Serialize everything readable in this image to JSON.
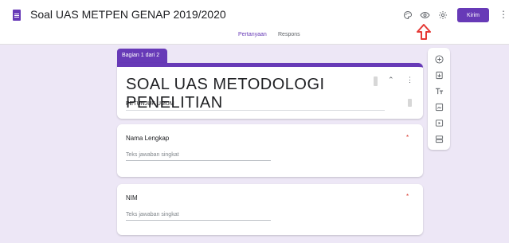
{
  "app": {
    "doc_title": "Soal UAS METPEN GENAP 2019/2020",
    "send_label": "Kirim"
  },
  "toolbar_icons": [
    "palette-icon",
    "preview-eye-icon",
    "settings-gear-icon",
    "more-vert-icon"
  ],
  "annotation": {
    "arrow_color": "#e53935",
    "points_to": "preview-eye-icon"
  },
  "tabs": [
    {
      "label": "Pertanyaan",
      "active": true
    },
    {
      "label": "Respons",
      "active": false
    }
  ],
  "section": {
    "tag_label": "Bagian 1 dari 2"
  },
  "form": {
    "title": "SOAL UAS METODOLOGI PENELITIAN",
    "description": "PETUNJUK UMUM"
  },
  "questions": [
    {
      "label": "Nama Lengkap",
      "placeholder": "Teks jawaban singkat",
      "required_mark": "*"
    },
    {
      "label": "NIM",
      "placeholder": "Teks jawaban singkat",
      "required_mark": "*"
    }
  ],
  "side_toolbar": [
    "add-question-icon",
    "import-questions-icon",
    "add-title-icon",
    "add-image-icon",
    "add-video-icon",
    "add-section-icon"
  ],
  "colors": {
    "accent": "#673ab7",
    "background": "#ede7f6",
    "required": "#d93025"
  }
}
